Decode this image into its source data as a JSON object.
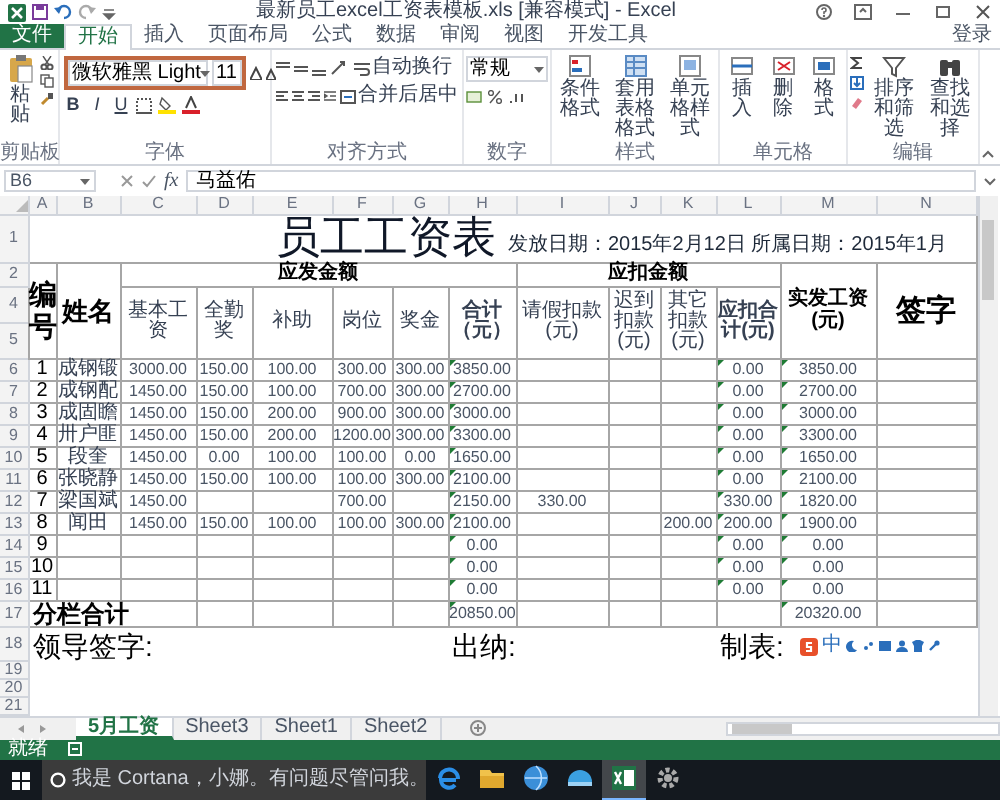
{
  "window": {
    "title": "最新员工excel工资表模板.xls [兼容模式] - Excel"
  },
  "ribbon_tabs": [
    {
      "label": "文件",
      "selected": false,
      "kind": "file"
    },
    {
      "label": "开始",
      "selected": true
    },
    {
      "label": "插入",
      "selected": false
    },
    {
      "label": "页面布局",
      "selected": false
    },
    {
      "label": "公式",
      "selected": false
    },
    {
      "label": "数据",
      "selected": false
    },
    {
      "label": "审阅",
      "selected": false
    },
    {
      "label": "视图",
      "selected": false
    },
    {
      "label": "开发工具",
      "selected": false
    }
  ],
  "sign_in": "登录",
  "clipboard": {
    "paste": "粘贴",
    "label": "剪贴板"
  },
  "font": {
    "name": "微软雅黑 Light",
    "size": "11",
    "styles": [
      "B",
      "I",
      "U"
    ],
    "label": "字体"
  },
  "alignment": {
    "wrap": "自动换行",
    "merge": "合并后居中",
    "label": "对齐方式"
  },
  "number": {
    "format": "常规",
    "label": "数字"
  },
  "styles": {
    "buttons": [
      "条件格式",
      "套用表格格式",
      "单元格样式"
    ],
    "label": "样式"
  },
  "cells_group": {
    "buttons": [
      "插入",
      "删除",
      "格式"
    ],
    "label": "单元格"
  },
  "editing": {
    "buttons": [
      "排序和筛选",
      "查找和选择"
    ],
    "label": "编辑"
  },
  "formula_bar": {
    "name_box": "B6",
    "fx": "fx",
    "formula": "马益佑"
  },
  "sheet": {
    "column_letters": [
      "A",
      "B",
      "C",
      "D",
      "E",
      "F",
      "G",
      "H",
      "I",
      "J",
      "K",
      "L",
      "M",
      "N"
    ],
    "title": "员工工资表",
    "dates": "发放日期：2015年2月12日 所属日期：2015年1月",
    "header_row_numbers": [
      "1",
      "2",
      "4",
      "5"
    ],
    "id_header": "编号",
    "name_header": "姓名",
    "group_headers": [
      "应发金额",
      "应扣金额"
    ],
    "column_headers": [
      {
        "text": "基本工资",
        "bold": false
      },
      {
        "text": "全勤奖",
        "bold": false
      },
      {
        "text": "补助",
        "bold": false
      },
      {
        "text": "岗位",
        "bold": false
      },
      {
        "text": "奖金",
        "bold": false
      },
      {
        "text": "合计（元）",
        "bold": true
      },
      {
        "text": "请假扣款(元)",
        "bold": false
      },
      {
        "text": "迟到扣款(元)",
        "bold": false
      },
      {
        "text": "其它扣款(元)",
        "bold": false
      },
      {
        "text": "应扣合计(元)",
        "bold": true
      }
    ],
    "net_header": "实发工资(元)",
    "sign_header": "签字",
    "rows": [
      {
        "kind": "data",
        "row_number": "6",
        "cells": {
          "A": "1",
          "B": "成钢锻",
          "C": "3000.00",
          "D": "150.00",
          "E": "100.00",
          "F": "300.00",
          "G": "300.00",
          "H": "3850.00",
          "L": "0.00",
          "M": "3850.00"
        },
        "flagged": true
      },
      {
        "kind": "data",
        "row_number": "7",
        "cells": {
          "A": "2",
          "B": "成钢配",
          "C": "1450.00",
          "D": "150.00",
          "E": "100.00",
          "F": "700.00",
          "G": "300.00",
          "H": "2700.00",
          "L": "0.00",
          "M": "2700.00"
        },
        "flagged": true
      },
      {
        "kind": "data",
        "row_number": "8",
        "cells": {
          "A": "3",
          "B": "成固瞻",
          "C": "1450.00",
          "D": "150.00",
          "E": "200.00",
          "F": "900.00",
          "G": "300.00",
          "H": "3000.00",
          "L": "0.00",
          "M": "3000.00"
        },
        "flagged": true
      },
      {
        "kind": "data",
        "row_number": "9",
        "cells": {
          "A": "4",
          "B": "卅户匪",
          "C": "1450.00",
          "D": "150.00",
          "E": "200.00",
          "F": "1200.00",
          "G": "300.00",
          "H": "3300.00",
          "L": "0.00",
          "M": "3300.00"
        },
        "flagged": true
      },
      {
        "kind": "data",
        "row_number": "10",
        "cells": {
          "A": "5",
          "B": "段奎",
          "C": "1450.00",
          "D": "0.00",
          "E": "100.00",
          "F": "100.00",
          "G": "0.00",
          "H": "1650.00",
          "L": "0.00",
          "M": "1650.00"
        },
        "flagged": true
      },
      {
        "kind": "data",
        "row_number": "11",
        "cells": {
          "A": "6",
          "B": "张晓静",
          "C": "1450.00",
          "D": "150.00",
          "E": "100.00",
          "F": "100.00",
          "G": "300.00",
          "H": "2100.00",
          "L": "0.00",
          "M": "2100.00"
        },
        "flagged": true
      },
      {
        "kind": "data",
        "row_number": "12",
        "cells": {
          "A": "7",
          "B": "梁国斌",
          "C": "1450.00",
          "F": "700.00",
          "H": "2150.00",
          "I": "330.00",
          "L": "330.00",
          "M": "1820.00"
        },
        "flagged": true
      },
      {
        "kind": "data",
        "row_number": "13",
        "cells": {
          "A": "8",
          "B": "闻田",
          "C": "1450.00",
          "D": "150.00",
          "E": "100.00",
          "F": "100.00",
          "G": "300.00",
          "H": "2100.00",
          "K": "200.00",
          "L": "200.00",
          "M": "1900.00"
        },
        "flagged": true
      },
      {
        "kind": "data",
        "row_number": "14",
        "cells": {
          "A": "9",
          "H": "0.00",
          "L": "0.00",
          "M": "0.00"
        },
        "flagged": true
      },
      {
        "kind": "data",
        "row_number": "15",
        "cells": {
          "A": "10",
          "H": "0.00",
          "L": "0.00",
          "M": "0.00"
        },
        "flagged": true
      },
      {
        "kind": "data",
        "row_number": "16",
        "cells": {
          "A": "11",
          "H": "0.00",
          "L": "0.00",
          "M": "0.00"
        },
        "flagged": true
      },
      {
        "kind": "total",
        "row_number": "17",
        "cells": {
          "A": "分栏合计",
          "H": "20850.00",
          "M": "20320.00"
        },
        "flagged": true
      },
      {
        "kind": "signature",
        "row_number": "18",
        "labels": [
          "领导签字:",
          "出纳:",
          "制表:"
        ]
      },
      {
        "kind": "blank",
        "row_number": "19"
      },
      {
        "kind": "blank",
        "row_number": "20"
      },
      {
        "kind": "blank",
        "row_number": "21"
      }
    ]
  },
  "ime_toolbar": {
    "mode": "中"
  },
  "sheet_tabs": [
    {
      "label": "5月工资",
      "selected": true
    },
    {
      "label": "Sheet3",
      "selected": false
    },
    {
      "label": "Sheet1",
      "selected": false
    },
    {
      "label": "Sheet2",
      "selected": false
    }
  ],
  "status_bar": {
    "text": "就绪"
  },
  "taskbar": {
    "search_placeholder": "我是 Cortana，小娜。有问题尽管问我。",
    "apps": [
      {
        "kind": "edge",
        "active": false
      },
      {
        "kind": "folder",
        "active": false
      },
      {
        "kind": "globe",
        "active": false
      },
      {
        "kind": "dome",
        "active": false
      },
      {
        "kind": "spreadsheet",
        "active": true
      },
      {
        "kind": "gear",
        "active": false
      }
    ]
  }
}
